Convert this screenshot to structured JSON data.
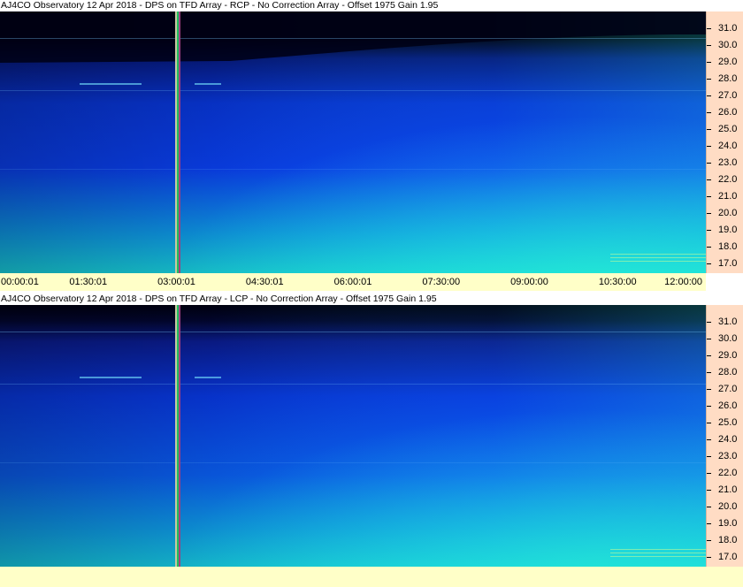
{
  "chart_data": [
    {
      "type": "heatmap",
      "title": "AJ4CO Observatory 12 Apr 2018 - DPS on TFD Array  - RCP  -  No Correction Array  -  Offset 1975  Gain 1.95",
      "x_tick_labels": [
        "00:00:01",
        "01:30:01",
        "03:00:01",
        "04:30:01",
        "06:00:01",
        "07:30:00",
        "09:00:00",
        "10:30:00",
        "12:00:00"
      ],
      "y_tick_labels": [
        "31.0",
        "30.0",
        "29.0",
        "28.0",
        "27.0",
        "26.0",
        "25.0",
        "24.0",
        "23.0",
        "22.0",
        "21.0",
        "20.0",
        "19.0",
        "18.0",
        "17.0"
      ],
      "y_ticks": [
        31.0,
        30.0,
        29.0,
        28.0,
        27.0,
        26.0,
        25.0,
        24.0,
        23.0,
        22.0,
        21.0,
        20.0,
        19.0,
        18.0,
        17.0
      ],
      "xlim": [
        "00:00:01",
        "12:00:00"
      ],
      "ylim": [
        16.4,
        32.0
      ],
      "colors": {
        "low": "#000010",
        "mid": "#0a40f0",
        "high": "#20e8d0",
        "axis_bg": "#ffdcc4",
        "time_bg": "#ffffc8"
      }
    },
    {
      "type": "heatmap",
      "title": "AJ4CO Observatory 12 Apr 2018 - DPS on TFD Array  - LCP  -  No Correction Array  -  Offset 1975  Gain 1.95",
      "y_tick_labels": [
        "31.0",
        "30.0",
        "29.0",
        "28.0",
        "27.0",
        "26.0",
        "25.0",
        "24.0",
        "23.0",
        "22.0",
        "21.0",
        "20.0",
        "19.0",
        "18.0",
        "17.0"
      ],
      "y_ticks": [
        31.0,
        30.0,
        29.0,
        28.0,
        27.0,
        26.0,
        25.0,
        24.0,
        23.0,
        22.0,
        21.0,
        20.0,
        19.0,
        18.0,
        17.0
      ],
      "xlim": [
        "00:00:01",
        "12:00:00"
      ],
      "ylim": [
        16.4,
        32.0
      ],
      "colors": {
        "low": "#000010",
        "mid": "#0a40f0",
        "high": "#20e8d0",
        "axis_bg": "#ffdcc4",
        "time_bg": "#ffffc8"
      }
    }
  ]
}
